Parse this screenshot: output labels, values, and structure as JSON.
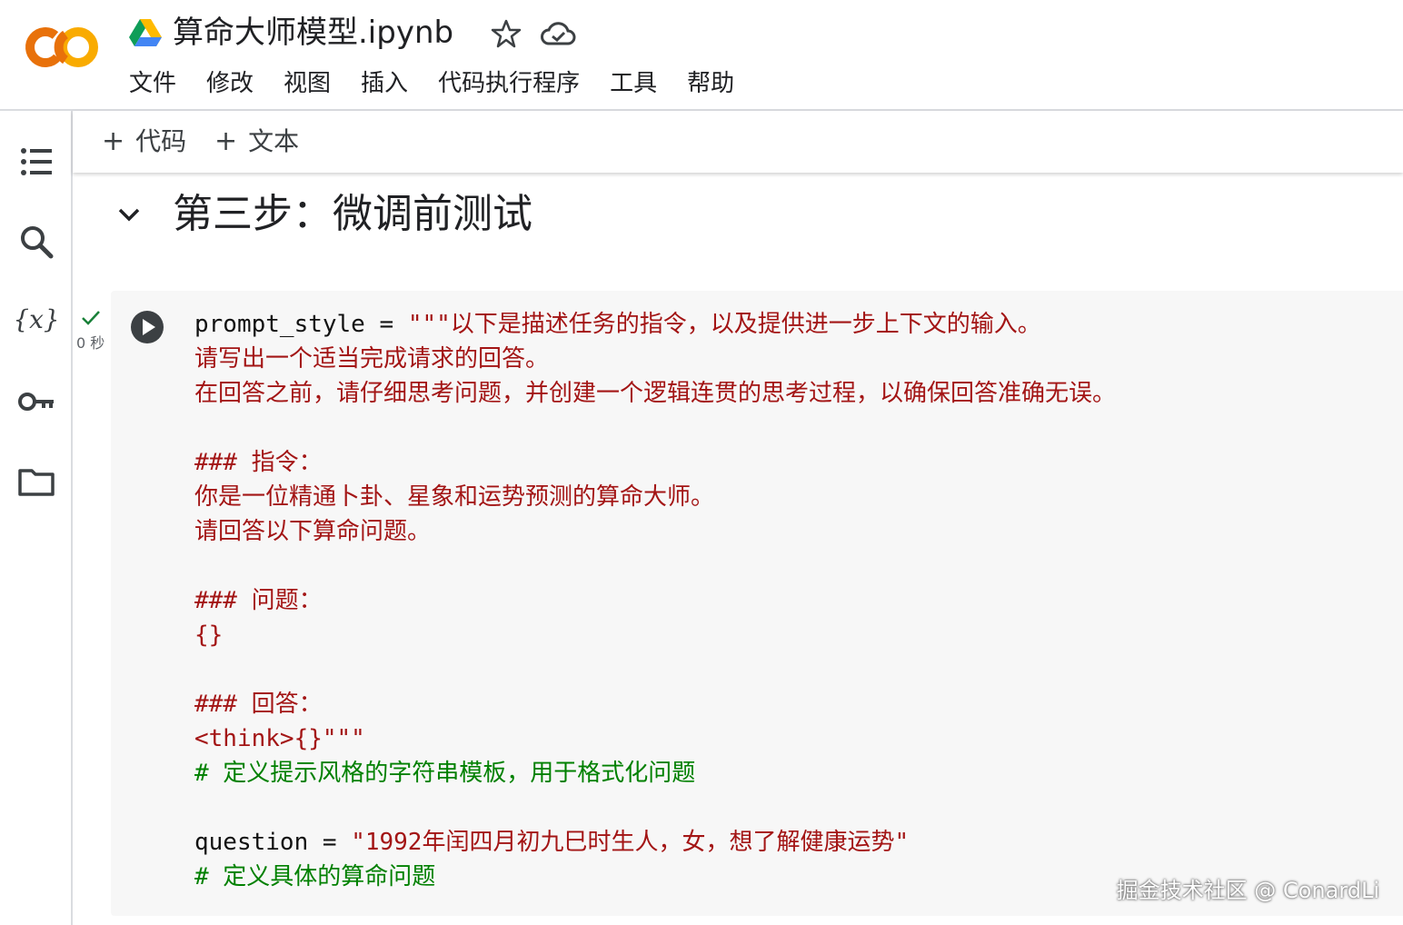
{
  "header": {
    "title": "算命大师模型.ipynb",
    "menu": [
      "文件",
      "修改",
      "视图",
      "插入",
      "代码执行程序",
      "工具",
      "帮助"
    ]
  },
  "toolbar": {
    "add_code_label": "代码",
    "add_text_label": "文本"
  },
  "section": {
    "title": "第三步：微调前测试"
  },
  "cell": {
    "exec_time": "0 秒",
    "lines": [
      [
        {
          "t": "prompt_style = ",
          "c": "plain"
        },
        {
          "t": "\"\"\"以下是描述任务的指令，以及提供进一步上下文的输入。",
          "c": "str"
        }
      ],
      [
        {
          "t": "请写出一个适当完成请求的回答。",
          "c": "str"
        }
      ],
      [
        {
          "t": "在回答之前，请仔细思考问题，并创建一个逻辑连贯的思考过程，以确保回答准确无误。",
          "c": "str"
        }
      ],
      [],
      [
        {
          "t": "### 指令：",
          "c": "str"
        }
      ],
      [
        {
          "t": "你是一位精通卜卦、星象和运势预测的算命大师。",
          "c": "str"
        }
      ],
      [
        {
          "t": "请回答以下算命问题。",
          "c": "str"
        }
      ],
      [],
      [
        {
          "t": "### 问题：",
          "c": "str"
        }
      ],
      [
        {
          "t": "{}",
          "c": "str"
        }
      ],
      [],
      [
        {
          "t": "### 回答：",
          "c": "str"
        }
      ],
      [
        {
          "t": "<think>{}\"\"\"",
          "c": "str"
        }
      ],
      [
        {
          "t": "# 定义提示风格的字符串模板，用于格式化问题",
          "c": "com"
        }
      ],
      [],
      [
        {
          "t": "question = ",
          "c": "plain"
        },
        {
          "t": "\"1992年闰四月初九巳时生人，女，想了解健康运势\"",
          "c": "str"
        }
      ],
      [
        {
          "t": "# 定义具体的算命问题",
          "c": "com"
        }
      ]
    ]
  },
  "watermark": "掘金技术社区 @ ConardLi",
  "icons": {
    "logo": "colab-logo",
    "drive": "google-drive-icon",
    "star": "star-icon",
    "cloud": "cloud-saved-icon",
    "rail": [
      "toc-icon",
      "search-icon",
      "variables-icon",
      "secrets-key-icon",
      "folder-icon"
    ]
  },
  "colors": {
    "logo_orange": "#F9AB00",
    "logo_dark_orange": "#E8710A",
    "string": "#a31515",
    "comment": "#008000",
    "cell_bg": "#f7f7f7",
    "check": "#188038"
  }
}
